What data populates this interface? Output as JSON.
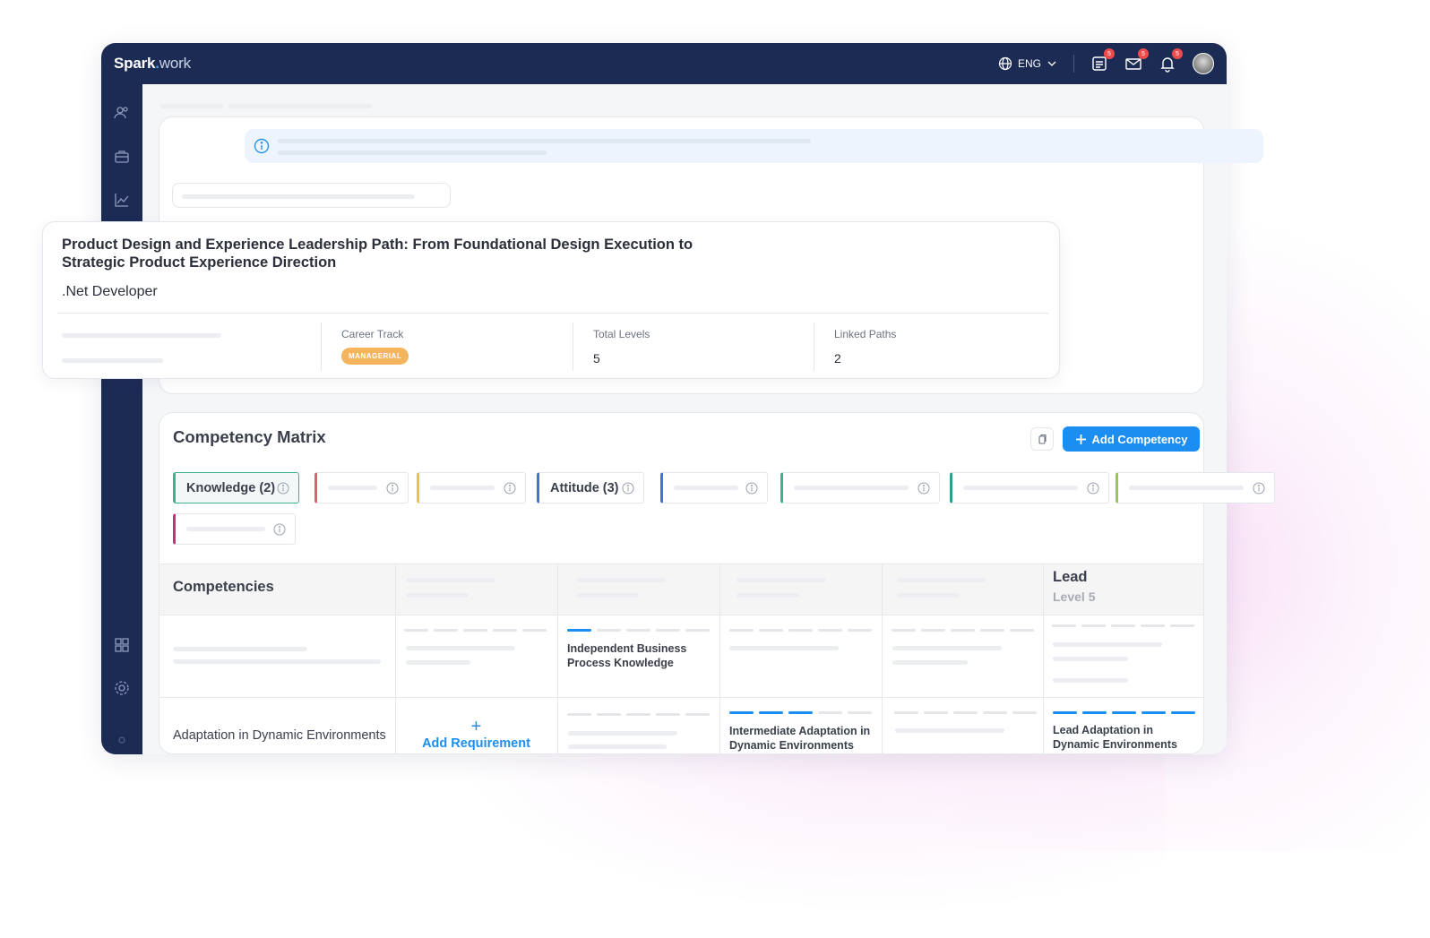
{
  "app": {
    "brand_main": "Spark",
    "brand_dot": ".",
    "brand_light": "work",
    "language": "ENG",
    "badges": {
      "tasks": "5",
      "messages": "5",
      "notifications": "5"
    }
  },
  "path_card": {
    "title": "Product Design and Experience Leadership Path: From Foundational Design Execution to Strategic Product Experience Direction",
    "subtitle": ".Net Developer",
    "career_track_label": "Career Track",
    "career_track_value": "MANAGERIAL",
    "total_levels_label": "Total Levels",
    "total_levels_value": "5",
    "linked_paths_label": "Linked Paths",
    "linked_paths_value": "2"
  },
  "matrix": {
    "title": "Competency Matrix",
    "add_button": "Add Competency",
    "chips": [
      {
        "label": "Knowledge (2)",
        "color": "#3bb38a"
      },
      {
        "label": "",
        "color": "#e0606c"
      },
      {
        "label": "",
        "color": "#f0c23b"
      },
      {
        "label": "Attitude (3)",
        "color": "#4b6fd8"
      },
      {
        "label": "",
        "color": "#4b6fd8"
      },
      {
        "label": "",
        "color": "#3bb38a"
      },
      {
        "label": "",
        "color": "#2e9d8a"
      },
      {
        "label": "",
        "color": "#9cc25a"
      },
      {
        "label": "",
        "color": "#c0357a"
      }
    ],
    "table": {
      "competencies_header": "Competencies",
      "lead_title": "Lead",
      "lead_level": "Level 5",
      "row1_col2_text": "Independent Business Process Knowledge",
      "row2_label": "Adaptation in Dynamic Environments",
      "add_requirement": "Add Requirement",
      "row2_col3_text": "Intermediate Adaptation in Dynamic Environments",
      "row2_col5_text": "Lead Adaptation in Dynamic Environments"
    }
  }
}
